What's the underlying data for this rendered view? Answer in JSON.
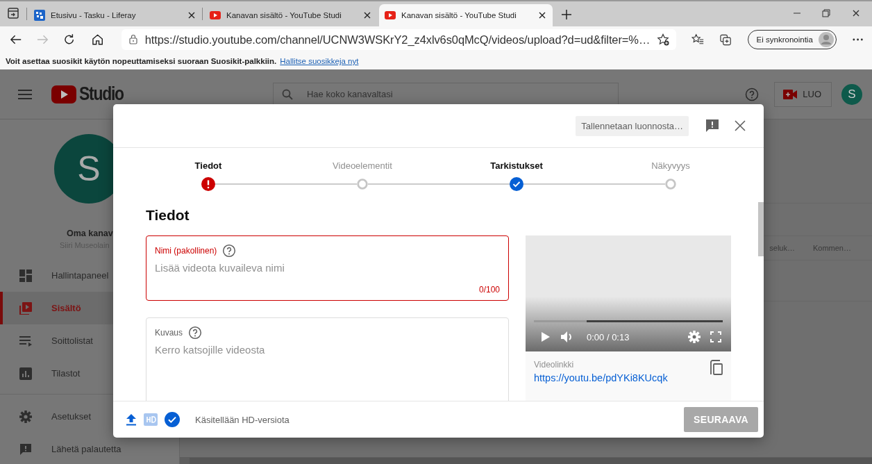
{
  "browser": {
    "tabs": [
      {
        "kind": "liferay",
        "title": "Etusivu - Tasku - Liferay",
        "selected": false
      },
      {
        "kind": "youtube",
        "title": "Kanavan sisältö - YouTube Studi",
        "selected": false
      },
      {
        "kind": "youtube",
        "title": "Kanavan sisältö - YouTube Studi",
        "selected": true
      }
    ],
    "address": "https://studio.youtube.com/channel/UCNW3WSKrY2_z4xlv6s0qMcQ/videos/upload?d=ud&filter=%…",
    "profile_button": "Ei synkronointia",
    "favorites_hint": {
      "text": "Voit asettaa suosikit käytön nopeuttamiseksi suoraan Suosikit-palkkiin.",
      "link": "Hallitse suosikkeja nyt"
    }
  },
  "studio": {
    "logo": "Studio",
    "search": {
      "placeholder": "Hae koko kanavaltasi"
    },
    "create_button": "LUO",
    "avatar": "S",
    "channel": {
      "avatar": "S",
      "name": "Oma kanav",
      "handle": "Siiri Museolain"
    },
    "nav": [
      {
        "kind": "dashboard",
        "label": "Hallintapaneel",
        "selected": false
      },
      {
        "kind": "content",
        "label": "Sisältö",
        "selected": true
      },
      {
        "kind": "playlists",
        "label": "Soittolistat",
        "selected": false
      },
      {
        "kind": "analytics",
        "label": "Tilastot",
        "selected": false
      },
      {
        "kind": "settings",
        "label": "Asetukset",
        "selected": false
      },
      {
        "kind": "feedback",
        "label": "Lähetä palautetta",
        "selected": false
      }
    ],
    "table_columns": [
      "seluk…",
      "Kommen…"
    ]
  },
  "dialog": {
    "status": "Tallennetaan luonnosta…",
    "steps": [
      {
        "label": "Tiedot",
        "kind": "error"
      },
      {
        "label": "Videoelementit",
        "kind": "pending"
      },
      {
        "label": "Tarkistukset",
        "kind": "done"
      },
      {
        "label": "Näkyvyys",
        "kind": "pending"
      }
    ],
    "heading": "Tiedot",
    "title_field": {
      "label": "Nimi (pakollinen)",
      "placeholder": "Lisää videota kuvaileva nimi",
      "counter": "0/100",
      "error": true
    },
    "description_field": {
      "label": "Kuvaus",
      "placeholder": "Kerro katsojille videosta",
      "error": false
    },
    "video": {
      "level": 0.28,
      "time": "0:00 / 0:13",
      "link_label": "Videolinkki",
      "link": "https://youtu.be/pdYKi8KUcqk"
    },
    "footer": {
      "status": "Käsitellään HD-versiota",
      "next_button": {
        "label": "SEURAAVA",
        "disabled": true
      }
    }
  }
}
